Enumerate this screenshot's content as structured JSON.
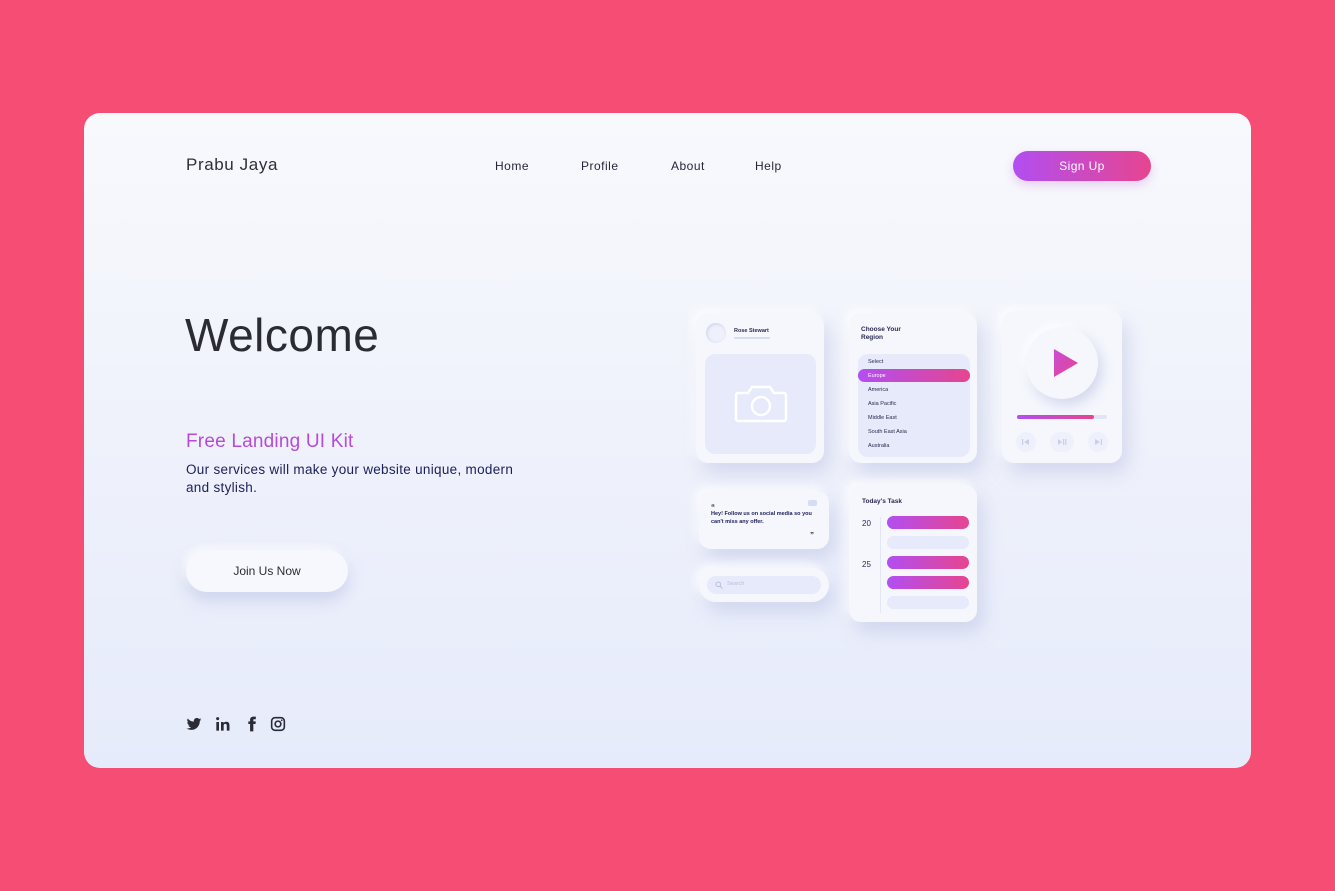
{
  "brand": "Prabu Jaya",
  "nav": [
    "Home",
    "Profile",
    "About",
    "Help"
  ],
  "signup_label": "Sign Up",
  "hero": {
    "title": "Welcome",
    "subtitle": "Free Landing UI Kit",
    "description": "Our services will make your website unique, modern and stylish.",
    "cta": "Join Us Now"
  },
  "social_icons": [
    "twitter-icon",
    "linkedin-icon",
    "facebook-icon",
    "instagram-icon"
  ],
  "widgets": {
    "profile": {
      "name": "Rose Stewart",
      "icon": "camera-icon"
    },
    "region": {
      "title_line1": "Choose Your",
      "title_line2": "Region",
      "items": [
        "Select",
        "Europe",
        "America",
        "Asia Pacific",
        "Middle East",
        "South East Asia",
        "Australia"
      ],
      "selected": "Europe"
    },
    "player": {
      "progress": 0.85
    },
    "quote": {
      "text": "Hey! Follow us on social media so you can't miss any offer."
    },
    "search": {
      "placeholder": "Search"
    },
    "tasks": {
      "title": "Today's Task",
      "dates": [
        "20",
        "25"
      ]
    }
  },
  "colors": {
    "background": "#f64d74",
    "accent_start": "#b24ef2",
    "accent_end": "#e6458f",
    "text_dark": "#2b2b36"
  }
}
